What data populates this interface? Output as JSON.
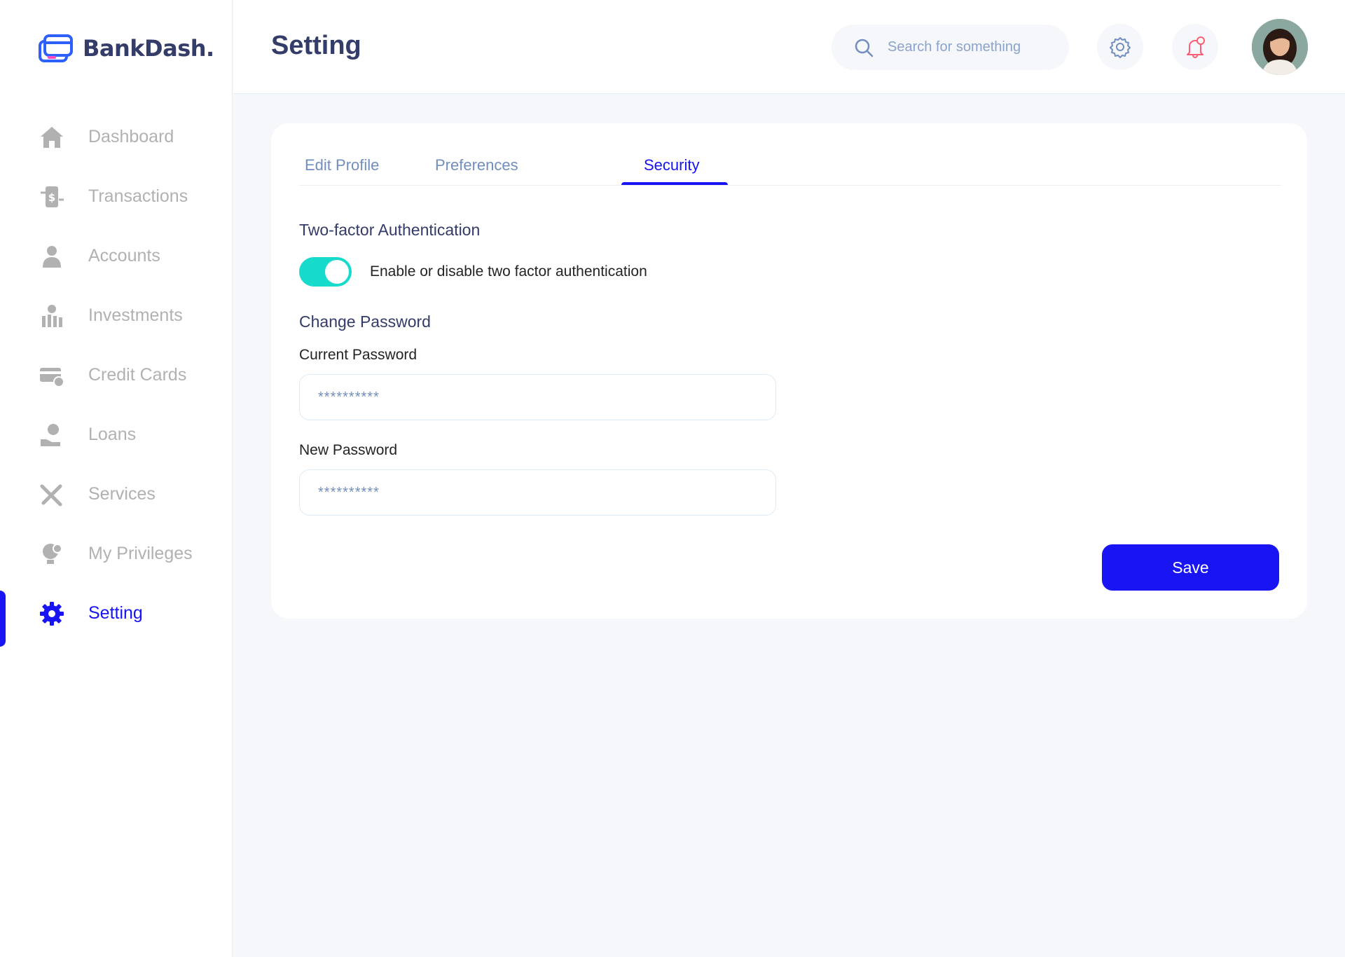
{
  "app": {
    "brand": "BankDash.",
    "accent": "#1814f3"
  },
  "sidebar": {
    "items": [
      {
        "label": "Dashboard",
        "icon": "home-icon",
        "active": false
      },
      {
        "label": "Transactions",
        "icon": "transfer-icon",
        "active": false
      },
      {
        "label": "Accounts",
        "icon": "user-icon",
        "active": false
      },
      {
        "label": "Investments",
        "icon": "investment-icon",
        "active": false
      },
      {
        "label": "Credit Cards",
        "icon": "credit-card-icon",
        "active": false
      },
      {
        "label": "Loans",
        "icon": "loan-icon",
        "active": false
      },
      {
        "label": "Services",
        "icon": "tools-icon",
        "active": false
      },
      {
        "label": "My Privileges",
        "icon": "privilege-icon",
        "active": false
      },
      {
        "label": "Setting",
        "icon": "gear-icon",
        "active": true
      }
    ]
  },
  "header": {
    "title": "Setting",
    "search_placeholder": "Search for something"
  },
  "tabs": [
    {
      "label": "Edit Profile",
      "active": false
    },
    {
      "label": "Preferences",
      "active": false
    },
    {
      "label": "Security",
      "active": true
    }
  ],
  "security": {
    "two_factor_title": "Two-factor Authentication",
    "two_factor_label": "Enable or disable two factor authentication",
    "two_factor_enabled": true,
    "change_password_title": "Change Password",
    "current_password_label": "Current Password",
    "current_password_value": "**********",
    "new_password_label": "New Password",
    "new_password_value": "**********",
    "save_label": "Save"
  },
  "colors": {
    "toggle_on": "#16dbcc",
    "muted_nav": "#b1b1b1",
    "tab_inactive": "#718ebf",
    "notification": "#fe5c73"
  }
}
